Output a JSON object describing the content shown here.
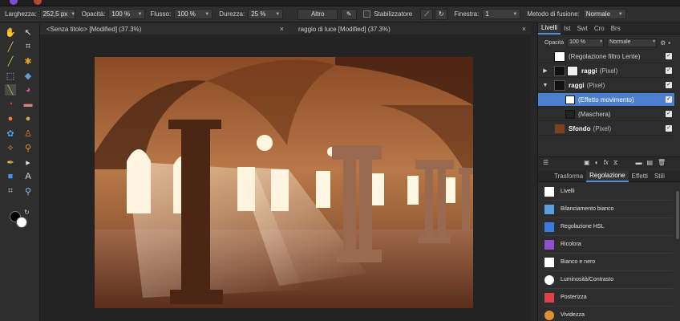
{
  "context_toolbar": {
    "width_label": "Larghezza:",
    "width_value": "252,5 px",
    "opacity_label": "Opacità:",
    "opacity_value": "100 %",
    "flow_label": "Flusso:",
    "flow_value": "100 %",
    "hardness_label": "Durezza:",
    "hardness_value": "25 %",
    "more_button": "Altro",
    "stabilizer_label": "Stabilizzatore",
    "window_label": "Finestra:",
    "window_value": "1",
    "blend_label": "Metodo di fusione:",
    "blend_value": "Normale"
  },
  "document_tabs": [
    {
      "label": "<Senza titolo> [Modified] (37.3%)",
      "close": "×"
    },
    {
      "label": "raggio di luce [Modified] (37.3%)",
      "close": "×"
    }
  ],
  "layers_panel": {
    "tabs": [
      "Livelli",
      "Ist",
      "Swt",
      "Cro",
      "Brs"
    ],
    "opacity_label": "Opacità",
    "opacity_value": "100 %",
    "blend_value": "Normale",
    "layers": [
      {
        "name": "(Regolazione filtro Lente)",
        "bold": "",
        "type": ""
      },
      {
        "name": "raggi",
        "bold": "raggi",
        "type": "(Pixel)"
      },
      {
        "name": "raggi",
        "bold": "raggi",
        "type": "(Pixel)"
      },
      {
        "name": "(Effetto movimento)",
        "bold": "",
        "type": ""
      },
      {
        "name": "(Maschera)",
        "bold": "",
        "type": ""
      },
      {
        "name": "Sfondo",
        "bold": "Sfondo",
        "type": "(Pixel)"
      }
    ]
  },
  "adjust_panel": {
    "tabs": [
      "Trasforma",
      "Regolazione",
      "Effetti",
      "Stili"
    ],
    "items": [
      "Livelli",
      "Bilanciamento bianco",
      "Regolazione HSL",
      "Ricolora",
      "Bianco e nero",
      "Luminosità/Contrasto",
      "Posterizza",
      "Vividezza"
    ]
  },
  "colors": {
    "accent": "#4a90e2",
    "selected_layer": "#4d7fd1",
    "panel_bg": "#2d2d2d"
  }
}
